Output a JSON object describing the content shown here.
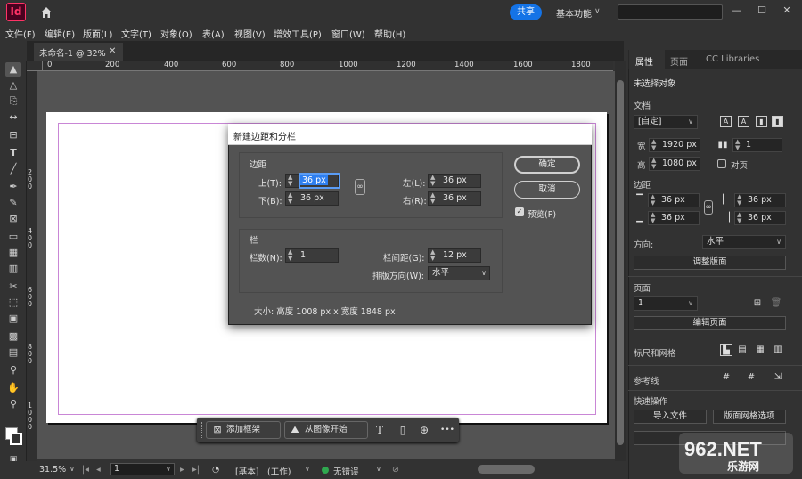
{
  "app": {
    "logo_text": "Id",
    "share_label": "共享",
    "workspace": "基本功能",
    "window_controls": [
      "—",
      "☐",
      "✕"
    ]
  },
  "menu": [
    "文件(F)",
    "编辑(E)",
    "版面(L)",
    "文字(T)",
    "对象(O)",
    "表(A)",
    "视图(V)",
    "增效工具(P)",
    "窗口(W)",
    "帮助(H)"
  ],
  "document_tab": {
    "title": "未命名-1 @ 32%",
    "close": "✕"
  },
  "ruler": {
    "top_labels": [
      "0",
      "200",
      "400",
      "600",
      "800",
      "1000",
      "1200",
      "1400",
      "1600",
      "1800"
    ],
    "left_labels": [
      "2\n0\n0",
      "4\n0\n0",
      "6\n0\n0",
      "8\n0\n0",
      "1\n0\n0\n0"
    ]
  },
  "dialog": {
    "title": "新建边距和分栏",
    "margins_heading": "边距",
    "top_label": "上(T):",
    "top_value": "36 px",
    "bottom_label": "下(B):",
    "bottom_value": "36 px",
    "left_label": "左(L):",
    "left_value": "36 px",
    "right_label": "右(R):",
    "right_value": "36 px",
    "columns_heading": "栏",
    "columns_label": "栏数(N):",
    "columns_value": "1",
    "gutter_label": "栏间距(G):",
    "gutter_value": "12 px",
    "direction_label": "排版方向(W):",
    "direction_value": "水平",
    "size_text": "大小: 高度 1008 px x 宽度 1848 px",
    "ok_label": "确定",
    "cancel_label": "取消",
    "preview_label": "预览(P)",
    "preview_checked": true
  },
  "taskbar": {
    "add_frame": "添加框架",
    "from_image": "从图像开始",
    "more": "•••"
  },
  "status": {
    "zoom": "31.5%",
    "page": "1",
    "master": "[基本]",
    "mode": "(工作)",
    "errors": "无错误"
  },
  "panel": {
    "tabs": [
      "属性",
      "页面",
      "CC Libraries"
    ],
    "no_selection": "未选择对象",
    "document_heading": "文档",
    "preset": "[自定]",
    "width_label": "宽",
    "width_value": "1920 px",
    "height_label": "高",
    "height_value": "1080 px",
    "pages_value": "1",
    "facing_pages": "对页",
    "margins_heading": "边距",
    "margin_values": [
      "36 px",
      "36 px",
      "36 px",
      "36 px"
    ],
    "direction_label": "方向:",
    "direction_value": "水平",
    "adjust_layout": "调整版面",
    "page_heading": "页面",
    "page_value": "1",
    "edit_page": "编辑页面",
    "rulers_grids": "标尺和网格",
    "guides": "参考线",
    "quick_actions": "快速操作",
    "import_file": "导入文件",
    "layout_grid_options": "版面网格选项"
  },
  "watermark": {
    "text": "962.NET",
    "subtext": "乐游网"
  },
  "colors": {
    "accent": "#1473e6",
    "brand": "#ff3366",
    "margin_guide": "#c986d6",
    "status_ok": "#2fa84f"
  }
}
